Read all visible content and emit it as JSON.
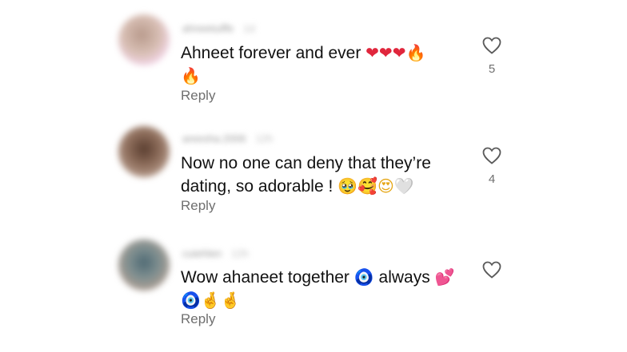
{
  "comments": [
    {
      "username": "ahneetuiffe",
      "time": "1d",
      "text_line1": "Ahneet forever and ever",
      "text_line1_emojis": [
        "❤",
        "❤",
        "❤",
        "🔥"
      ],
      "text_line2_emojis": [
        "🔥"
      ],
      "reply_label": "Reply",
      "like_count": "5",
      "avatar_color": "#d8b8a8"
    },
    {
      "username": "areesha.2006",
      "time": "12h",
      "text_line1": "Now no one can deny that they’re",
      "text_line2": "dating, so adorable !",
      "text_line2_emojis": [
        "🥹",
        "🥰",
        "😍",
        "🤍"
      ],
      "reply_label": "Reply",
      "like_count": "4",
      "avatar_color": "#7a5a48"
    },
    {
      "username": "cutehlen",
      "time": "12h",
      "text_line1_a": "Wow ahaneet together",
      "text_line1_b": "always",
      "text_line1_emoji_a": "🧿",
      "text_line1_emoji_b": "💕",
      "text_line2_emojis": [
        "🧿",
        "🤞",
        "🤞"
      ],
      "reply_label": "Reply",
      "like_count": "",
      "avatar_color": "#6f7f88"
    }
  ],
  "icons": {
    "like": "heart-outline-icon"
  },
  "colors": {
    "text": "#111111",
    "secondary": "#6f6f6f",
    "background": "#ffffff"
  }
}
